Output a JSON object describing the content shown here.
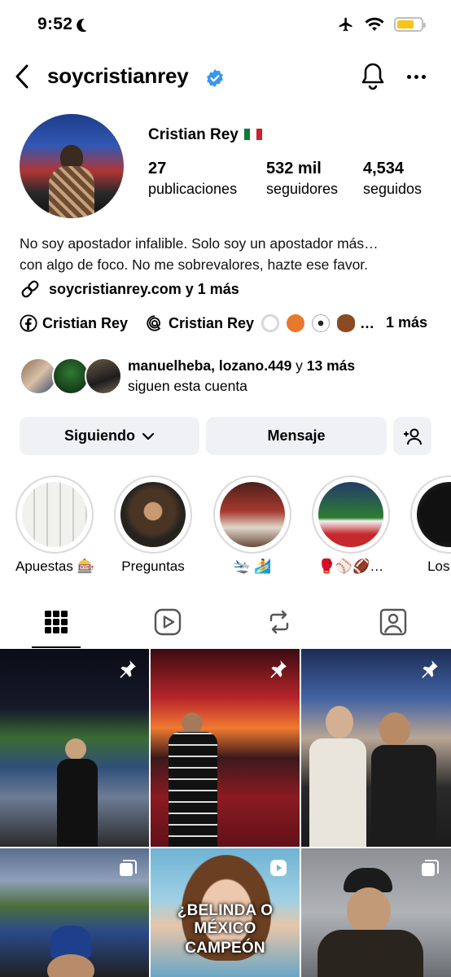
{
  "status_bar": {
    "time": "9:52"
  },
  "header": {
    "username": "soycristianrey"
  },
  "profile": {
    "name": "Cristian Rey",
    "stats": [
      {
        "value": "27",
        "label": "publicaciones"
      },
      {
        "value": "532 mil",
        "label": "seguidores"
      },
      {
        "value": "4,534",
        "label": "seguidos"
      }
    ],
    "bio_line1": "No soy apostador infalible. Solo soy un apostador más…",
    "bio_line2": "con algo de foco. No me sobrevalores, hazte ese favor.",
    "link_text": "soycristianrey.com y 1 más",
    "facebook_name": "Cristian Rey",
    "threads_name": "Cristian Rey",
    "threads_ellipsis": "…",
    "social_more": "1 más",
    "followed_by_names": "manuelheba, lozano.449",
    "followed_by_connector": " y ",
    "followed_by_more": "13 más",
    "followed_by_suffix": "siguen esta cuenta"
  },
  "actions": {
    "following_label": "Siguiendo",
    "message_label": "Mensaje"
  },
  "highlights": [
    {
      "label": "Apuestas 🎰"
    },
    {
      "label": "Preguntas"
    },
    {
      "label": "🛬 🏄"
    },
    {
      "label": "🥊⚾🏈…"
    },
    {
      "label": "Los Re"
    }
  ],
  "tabs": [
    "grid-icon",
    "reels-icon",
    "reposts-icon",
    "tagged-icon"
  ],
  "posts": [
    {
      "badge": "pin-icon"
    },
    {
      "badge": "pin-icon"
    },
    {
      "badge": "pin-icon"
    },
    {
      "badge": "carousel-icon"
    },
    {
      "badge": "reel-icon",
      "overlay_title": "¿BELINDA O MÉXICO",
      "overlay_title2": "CAMPEÓN"
    },
    {
      "badge": "carousel-icon"
    }
  ],
  "colors": {
    "verified": "#3897f0",
    "button_bg": "#eff1f4",
    "battery": "#f5c518"
  }
}
